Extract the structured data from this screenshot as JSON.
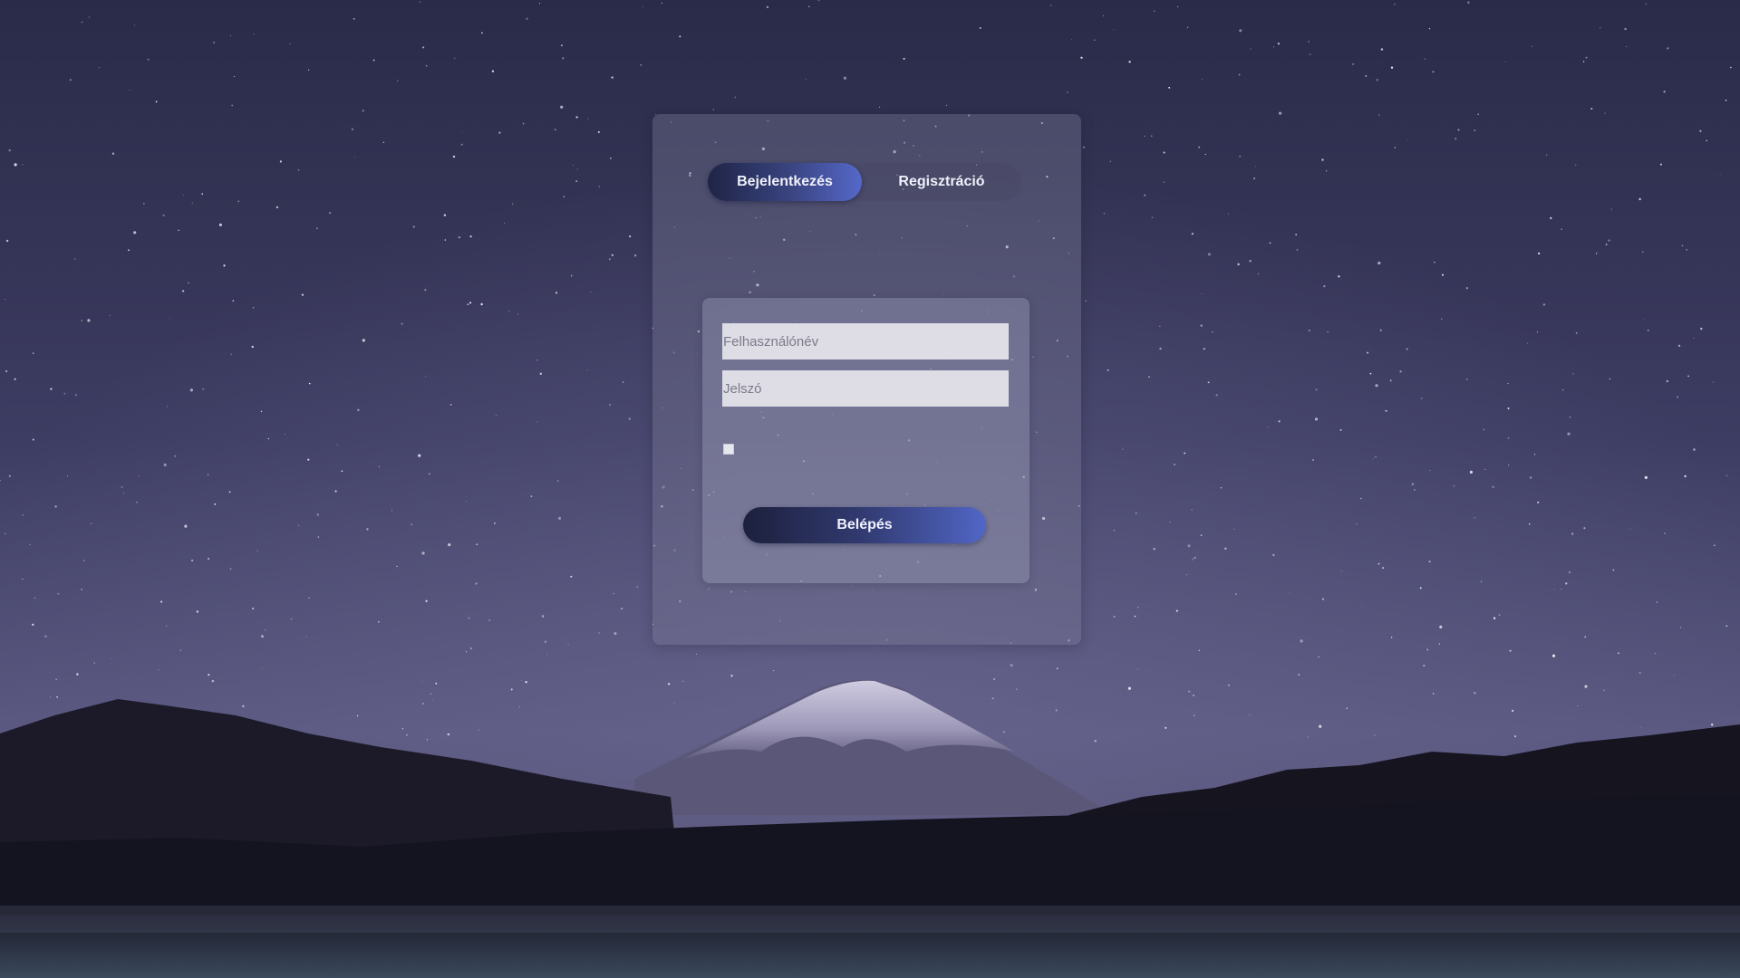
{
  "tabs": {
    "login_label": "Bejelentkezés",
    "register_label": "Regisztráció",
    "active": "login"
  },
  "form": {
    "username_placeholder": "Felhasználónév",
    "username_value": "",
    "password_placeholder": "Jelszó",
    "password_value": "",
    "remember_checked": false,
    "submit_label": "Belépés"
  },
  "theme": {
    "accent": "#5166c6",
    "accent_dark": "#1c203c",
    "sky_top": "#2c2d4c",
    "sky_bottom": "#5d5b80"
  },
  "background": {
    "subject": "starry-night-mountain-icon"
  }
}
